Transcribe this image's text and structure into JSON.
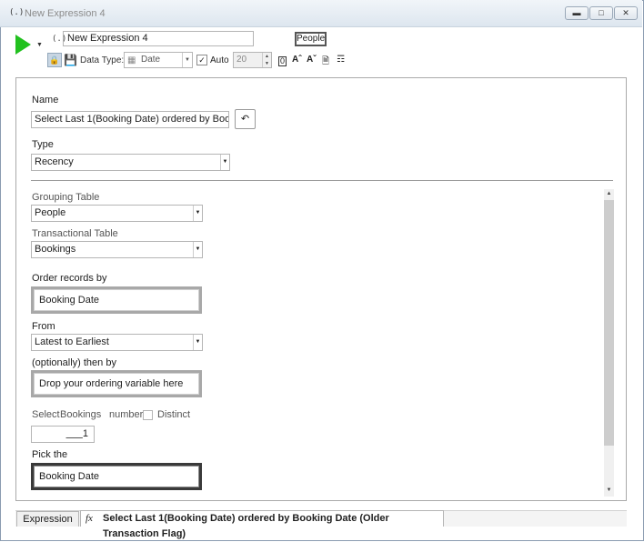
{
  "window": {
    "title": "New Expression 4",
    "icon": "expression-icon",
    "controls": [
      "minimize-icon",
      "maximize-icon",
      "close-icon"
    ]
  },
  "toolbar": {
    "expression_name": "New Expression 4",
    "table_chip": "People",
    "data_type_label": "Data Type:",
    "data_type_value": "Date",
    "auto_label": "Auto",
    "auto_checked": true,
    "length_value": "20",
    "icons": [
      "run-icon",
      "lock-icon",
      "save-icon",
      "calendar-icon",
      "field-size-icon",
      "font-increase-icon",
      "font-decrease-icon",
      "document-icon",
      "hierarchy-icon"
    ]
  },
  "form": {
    "name_label": "Name",
    "name_value": "Select Last 1(Booking Date) ordered by Booking I",
    "type_label": "Type",
    "type_value": "Recency",
    "grouping_table_label": "Grouping Table",
    "grouping_table_value": "People",
    "transactional_table_label": "Transactional Table",
    "transactional_table_value": "Bookings",
    "order_by_label": "Order records by",
    "order_by_value": "Booking Date",
    "from_label": "From",
    "from_value": "Latest to Earliest",
    "then_by_label": "(optionally) then by",
    "then_by_placeholder": "Drop your ordering variable here",
    "select_label": "Select",
    "select_table": "Bookings",
    "select_number": "number",
    "distinct_label": "Distinct",
    "distinct_checked": false,
    "count_value": "1",
    "pick_label": "Pick the",
    "pick_value": "Booking Date"
  },
  "bottom_tabs": {
    "expression_tab": "Expression",
    "formula_text": "Select Last 1(Booking Date) ordered by Booking Date (Older Transaction Flag)"
  }
}
